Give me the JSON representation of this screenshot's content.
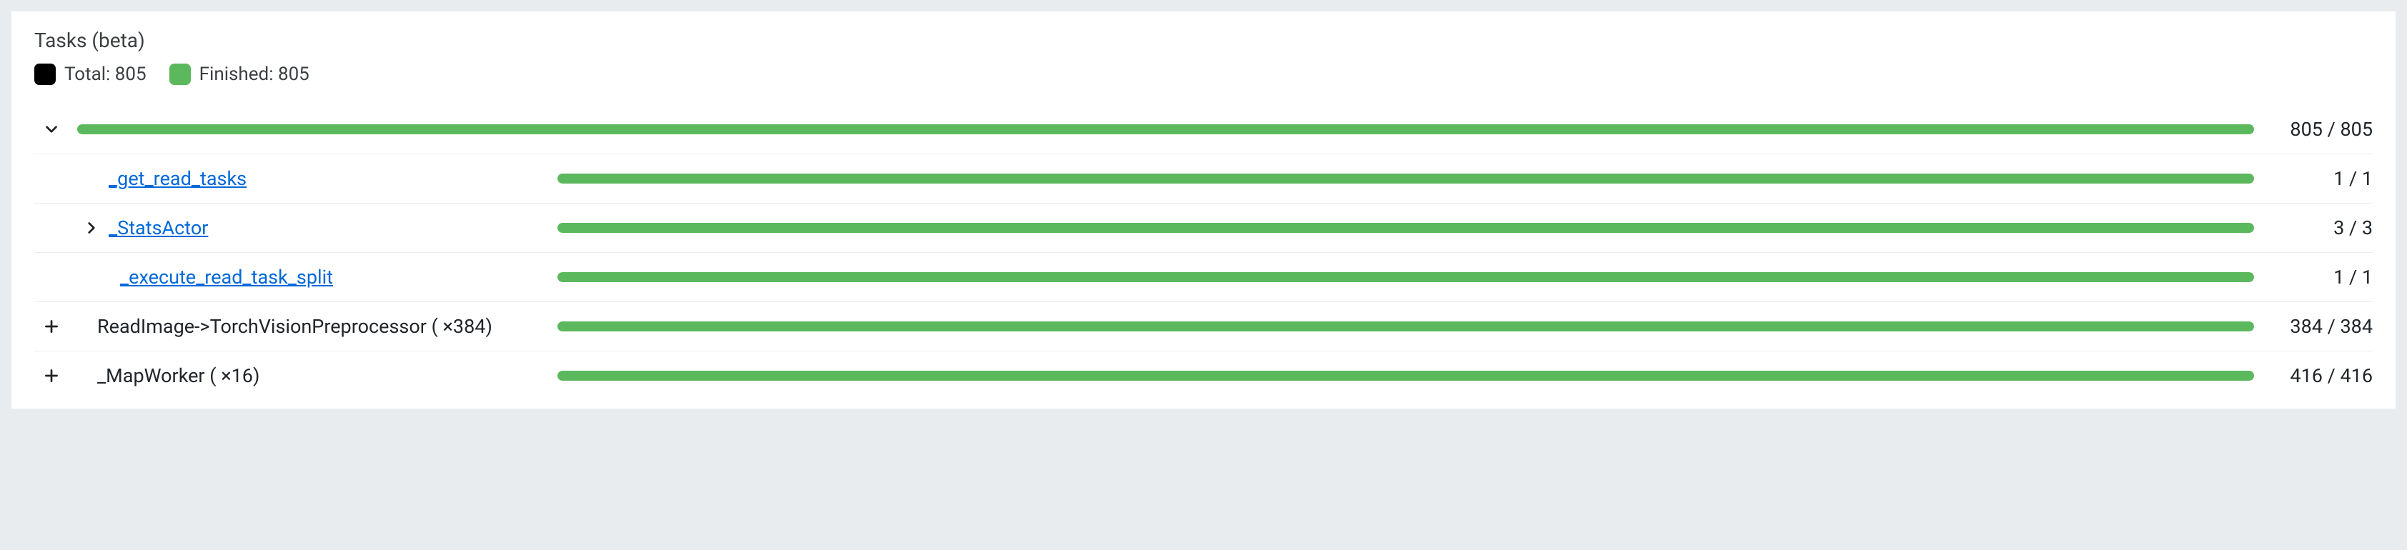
{
  "panel": {
    "title": "Tasks (beta)"
  },
  "legend": {
    "total_label": "Total: 805",
    "finished_label": "Finished: 805"
  },
  "summary": {
    "count": "805 / 805"
  },
  "rows": {
    "r1": {
      "label": "_get_read_tasks",
      "count": "1 / 1"
    },
    "r2": {
      "label": "_StatsActor",
      "count": "3 / 3"
    },
    "r3": {
      "label": "_execute_read_task_split",
      "count": "1 / 1"
    },
    "r4": {
      "label": "ReadImage->TorchVisionPreprocessor ( ×384)",
      "count": "384 / 384"
    },
    "r5": {
      "label": "_MapWorker ( ×16)",
      "count": "416 / 416"
    }
  },
  "colors": {
    "finished": "#5cb85c",
    "total": "#000000",
    "link": "#0068d9"
  },
  "chart_data": [
    {
      "type": "bar",
      "title": "Summary",
      "categories": [
        "Finished"
      ],
      "values": [
        805
      ],
      "ylim": [
        0,
        805
      ]
    },
    {
      "type": "bar",
      "title": "_get_read_tasks",
      "categories": [
        "Finished"
      ],
      "values": [
        1
      ],
      "ylim": [
        0,
        1
      ]
    },
    {
      "type": "bar",
      "title": "_StatsActor",
      "categories": [
        "Finished"
      ],
      "values": [
        3
      ],
      "ylim": [
        0,
        3
      ]
    },
    {
      "type": "bar",
      "title": "_execute_read_task_split",
      "categories": [
        "Finished"
      ],
      "values": [
        1
      ],
      "ylim": [
        0,
        1
      ]
    },
    {
      "type": "bar",
      "title": "ReadImage->TorchVisionPreprocessor",
      "categories": [
        "Finished"
      ],
      "values": [
        384
      ],
      "ylim": [
        0,
        384
      ]
    },
    {
      "type": "bar",
      "title": "_MapWorker",
      "categories": [
        "Finished"
      ],
      "values": [
        416
      ],
      "ylim": [
        0,
        416
      ]
    }
  ]
}
